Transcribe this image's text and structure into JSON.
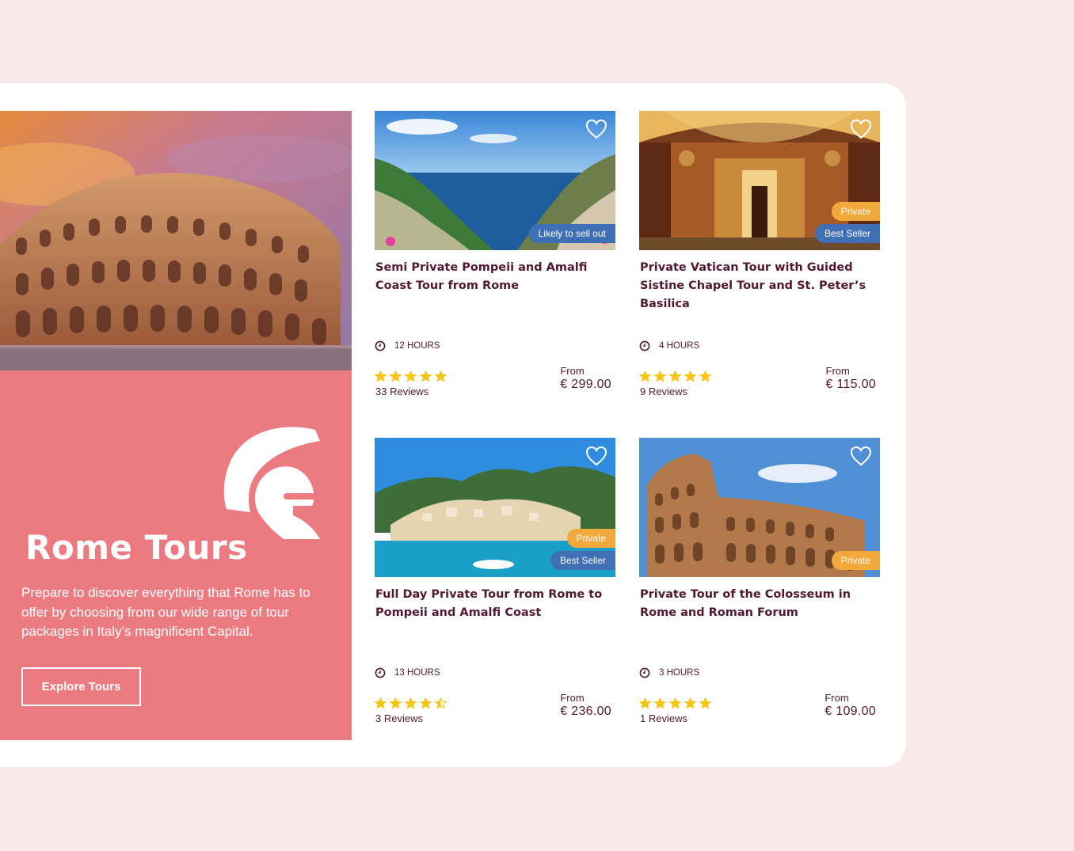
{
  "hero": {
    "title": "Rome Tours",
    "description": "Prepare to discover everything that Rome has to offer by choosing from our wide range of tour packages in Italy’s magnificent Capital.",
    "button_label": "Explore Tours",
    "image_icon": "colosseum-photo",
    "logo_icon": "roman-helmet-icon"
  },
  "colors": {
    "accent": "#ec7b81",
    "title": "#52182e",
    "orange_badge": "#f2a93b",
    "blue_badge": "#3f6fb5",
    "star": "#f5c518"
  },
  "cards": [
    {
      "title": "Semi Private Pompeii and Amalfi Coast Tour from Rome",
      "duration": "12 HOURS",
      "rating": 5,
      "reviews": "33 Reviews",
      "from_label": "From",
      "price": "€ 299.00",
      "badges": [
        "Likely to sell out"
      ]
    },
    {
      "title": "Private Vatican Tour with Guided Sistine Chapel Tour and St. Peter’s Basilica",
      "duration": "4 HOURS",
      "rating": 5,
      "reviews": "9 Reviews",
      "from_label": "From",
      "price": "€ 115.00",
      "badges": [
        "Private",
        "Best Seller"
      ]
    },
    {
      "title": "Full Day Private Tour from Rome to Pompeii and Amalfi Coast",
      "duration": "13 HOURS",
      "rating": 4.5,
      "reviews": "3 Reviews",
      "from_label": "From",
      "price": "€ 236.00",
      "badges": [
        "Private",
        "Best Seller"
      ]
    },
    {
      "title": "Private Tour of the Colosseum in Rome and Roman Forum",
      "duration": "3 HOURS",
      "rating": 5,
      "reviews": "1 Reviews",
      "from_label": "From",
      "price": "€ 109.00",
      "badges": [
        "Private"
      ]
    }
  ]
}
